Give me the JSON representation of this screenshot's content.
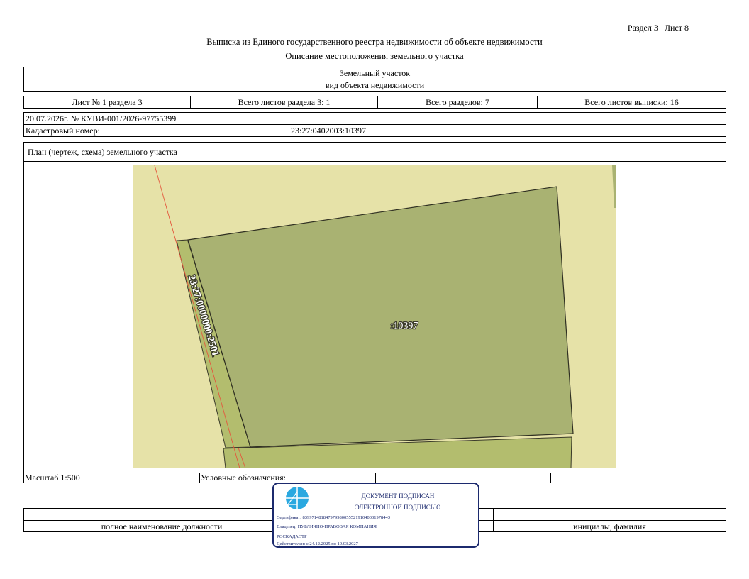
{
  "header": {
    "section_sheet": "Раздел 3   Лист 8",
    "title": "Выписка из Единого государственного реестра недвижимости об объекте недвижимости",
    "subtitle": "Описание местоположения земельного участка"
  },
  "object": {
    "type": "Земельный участок",
    "type_caption": "вид объекта недвижимости"
  },
  "sheets": {
    "sheet_no": "Лист № 1 раздела 3",
    "total_section_sheets": "Всего листов раздела 3: 1",
    "total_sections": "Всего разделов: 7",
    "total_extract_sheets": "Всего листов выписки: 16"
  },
  "doc": {
    "date_number": "20.07.2026г. № КУВИ-001/2026-97755399",
    "cadastral_label": "Кадастровый номер:",
    "cadastral_value": "23:27:0402003:10397"
  },
  "plan": {
    "title": "План (чертеж, схема) земельного участка",
    "parcel_label": ":10397",
    "neighbor_label": "23:27:0000000:2501",
    "colors": {
      "background": "#e6e2a8",
      "parcel_fill": "#a9b272",
      "strip_fill": "#b3bd6e",
      "red_line": "#e4573d"
    }
  },
  "footer": {
    "scale": "Масштаб 1:500",
    "legend_label": "Условные обозначения:",
    "position_caption": "полное наименование должности",
    "signature_caption": "инициалы, фамилия"
  },
  "stamp": {
    "line1": "ДОКУМЕНТ ПОДПИСАН",
    "line2": "ЭЛЕКТРОННОЙ ПОДПИСЬЮ",
    "certificate": "Сертификат: 8399714818479799800555219104000197844З",
    "owner": "Владелец: ПУБЛИЧНО-ПРАВОВАЯ КОМПАНИЯ",
    "owner_cont": "РОСКАДАСТР",
    "valid": "Действителен: с 24.12.2025 по 19.03.2027",
    "accent_color": "#1c2a6e",
    "logo_color": "#2aa8e0",
    "logo": "roskadastr-logo-icon"
  }
}
